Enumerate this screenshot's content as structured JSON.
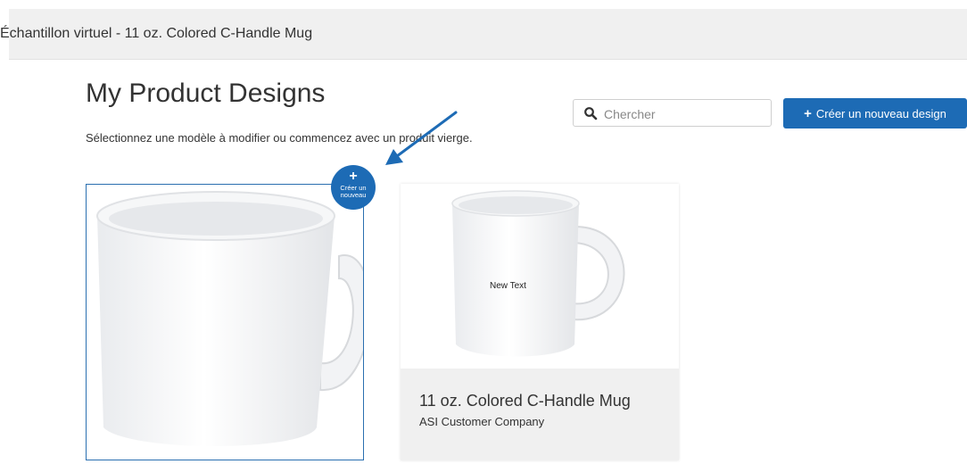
{
  "header": {
    "title": "Échantillon virtuel - 11 oz. Colored C-Handle Mug"
  },
  "main": {
    "title": "My Product Designs",
    "subtitle": "Sélectionnez une modèle à modifier ou commencez avec un produit vierge."
  },
  "search": {
    "placeholder": "Chercher",
    "value": ""
  },
  "new_design_button": {
    "label": "Créer un nouveau design"
  },
  "blank_card": {
    "badge_line1": "Créer un",
    "badge_line2": "nouveau"
  },
  "designs": [
    {
      "mug_text": "New Text",
      "name": "11 oz. Colored C-Handle Mug",
      "company": "ASI Customer Company"
    }
  ],
  "colors": {
    "accent": "#1d6bb5",
    "card_footer": "#f0f0f0",
    "header_bg": "#f0f0f0"
  }
}
